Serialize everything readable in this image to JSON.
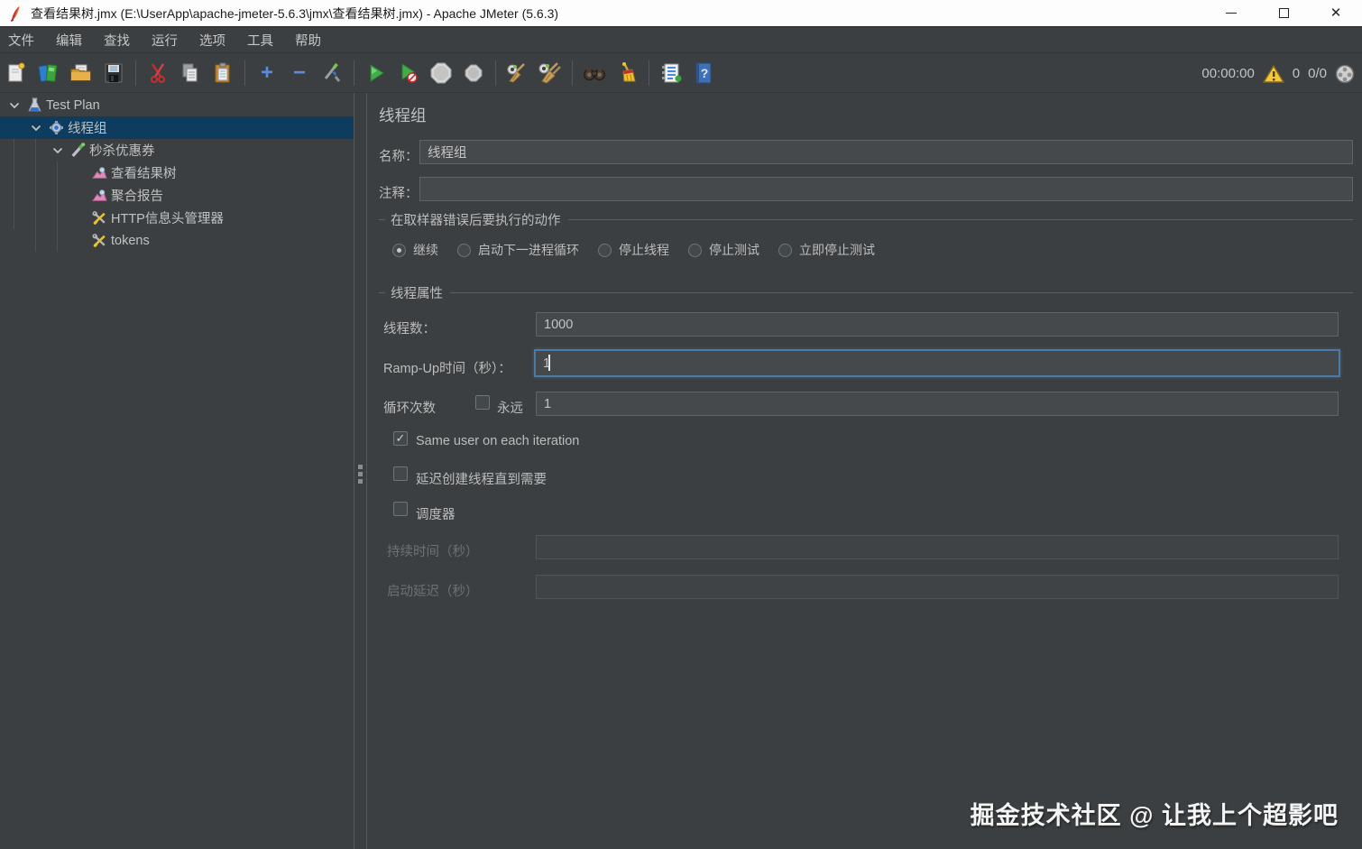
{
  "window": {
    "title": "查看结果树.jmx (E:\\UserApp\\apache-jmeter-5.6.3\\jmx\\查看结果树.jmx) - Apache JMeter (5.6.3)"
  },
  "menu": {
    "items": [
      {
        "label": "文件"
      },
      {
        "label": "编辑"
      },
      {
        "label": "查找"
      },
      {
        "label": "运行"
      },
      {
        "label": "选项"
      },
      {
        "label": "工具"
      },
      {
        "label": "帮助"
      }
    ]
  },
  "toolbar": {
    "icons": [
      "new",
      "templates",
      "open",
      "save",
      "cut",
      "copy",
      "paste",
      "add",
      "remove",
      "toggle",
      "start",
      "start-no-timers",
      "stop",
      "shutdown",
      "clear",
      "clear-all",
      "search",
      "reset-search",
      "function-helper",
      "help"
    ],
    "timer": "00:00:00",
    "warning_count": "0",
    "thread_count": "0/0"
  },
  "tree": {
    "items": [
      {
        "label": "Test Plan",
        "level": 0,
        "expanded": true,
        "selected": false
      },
      {
        "label": "线程组",
        "level": 1,
        "expanded": true,
        "selected": true
      },
      {
        "label": "秒杀优惠券",
        "level": 2,
        "expanded": true,
        "selected": false
      },
      {
        "label": "查看结果树",
        "level": 3,
        "selected": false
      },
      {
        "label": "聚合报告",
        "level": 3,
        "selected": false
      },
      {
        "label": "HTTP信息头管理器",
        "level": 3,
        "selected": false
      },
      {
        "label": "tokens",
        "level": 3,
        "selected": false
      }
    ]
  },
  "main": {
    "title": "线程组",
    "name_label": "名称：",
    "name_value": "线程组",
    "comment_label": "注释：",
    "comment_value": "",
    "error_action": {
      "legend": "在取样器错误后要执行的动作",
      "options": [
        {
          "label": "继续",
          "selected": true
        },
        {
          "label": "启动下一进程循环",
          "selected": false
        },
        {
          "label": "停止线程",
          "selected": false
        },
        {
          "label": "停止测试",
          "selected": false
        },
        {
          "label": "立即停止测试",
          "selected": false
        }
      ]
    },
    "thread_props": {
      "legend": "线程属性",
      "threads_label": "线程数：",
      "threads_value": "1000",
      "rampup_label": "Ramp-Up时间（秒）：",
      "rampup_value": "1",
      "loop_label": "循环次数",
      "loop_forever_label": "永远",
      "loop_forever_checked": false,
      "loop_value": "1",
      "same_user_label": "Same user on each iteration",
      "same_user_checked": true,
      "delay_create_label": "延迟创建线程直到需要",
      "delay_create_checked": false,
      "scheduler_label": "调度器",
      "scheduler_checked": false,
      "duration_label": "持续时间（秒）",
      "duration_value": "",
      "startup_delay_label": "启动延迟（秒）",
      "startup_delay_value": ""
    }
  },
  "watermark": "掘金技术社区 @ 让我上个超影吧",
  "colors": {
    "panel_bg": "#3c3f41",
    "selection": "#0d3c5e",
    "focus_border": "#4a7ba6",
    "accent_green": "#3fae49",
    "warning_yellow": "#f5c63a"
  }
}
